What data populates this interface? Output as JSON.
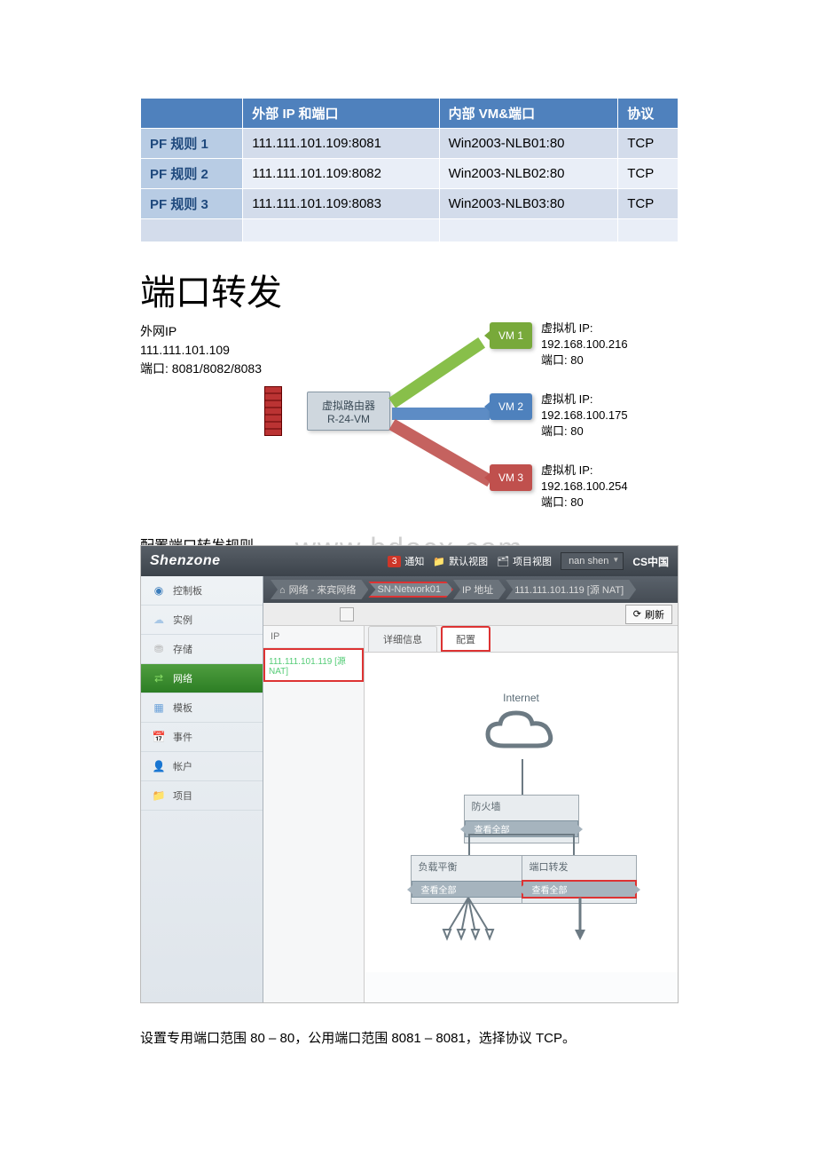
{
  "pf_table": {
    "headers": [
      "",
      "外部 IP 和端口",
      "内部 VM&端口",
      "协议"
    ],
    "rows": [
      {
        "rule": "PF 规则 1",
        "ext": "111.111.101.109:8081",
        "int": "Win2003-NLB01:80",
        "proto": "TCP"
      },
      {
        "rule": "PF 规则 2",
        "ext": "111.111.101.109:8082",
        "int": "Win2003-NLB02:80",
        "proto": "TCP"
      },
      {
        "rule": "PF 规则 3",
        "ext": "111.111.101.109:8083",
        "int": "Win2003-NLB03:80",
        "proto": "TCP"
      }
    ]
  },
  "big_title": "端口转发",
  "pf_diag": {
    "source": {
      "label": "外网IP",
      "ip": "111.111.101.109",
      "ports": "端口: 8081/8082/8083"
    },
    "router": {
      "l1": "虚拟路由器",
      "l2": "R-24-VM"
    },
    "vm_labels": [
      "VM 1",
      "VM 2",
      "VM 3"
    ],
    "vm_texts": {
      "t1": {
        "ip": "虚拟机 IP: 192.168.100.216",
        "port": "端口: 80"
      },
      "t2": {
        "ip": "虚拟机 IP: 192.168.100.175",
        "port": "端口: 80"
      },
      "t3": {
        "ip": "虚拟机 IP: 192.168.100.254",
        "port": "端口: 80"
      }
    }
  },
  "sub_title": "配置端口转发规则",
  "watermark": "www.bdocx.com",
  "console": {
    "logo": "Shenzone",
    "notif_count": "3",
    "notif_label": "通知",
    "view_default": "默认视图",
    "view_project": "项目视图",
    "user": "nan shen",
    "brand": "CS中国",
    "sidebar": {
      "items": [
        {
          "label": "控制板"
        },
        {
          "label": "实例"
        },
        {
          "label": "存储"
        },
        {
          "label": "网络"
        },
        {
          "label": "模板"
        },
        {
          "label": "事件"
        },
        {
          "label": "帐户"
        },
        {
          "label": "项目"
        }
      ]
    },
    "breadcrumbs": {
      "seg1": "网络 - 来宾网络",
      "seg2": "SN-Network01",
      "seg3": "IP 地址",
      "seg4": "111.111.101.119 [源 NAT]"
    },
    "refresh": "刷新",
    "ip_panel_header": "IP",
    "ip_panel_value": "111.111.101.119 [源 NAT]",
    "tabs": {
      "details": "详细信息",
      "config": "配置"
    },
    "topo": {
      "cloud": "Internet",
      "firewall": "防火墙",
      "view_all": "查看全部",
      "loadbalance": "负载平衡",
      "port_forward": "端口转发"
    }
  },
  "footer": "设置专用端口范围 80 – 80，公用端口范围 8081 – 8081，选择协议 TCP。"
}
